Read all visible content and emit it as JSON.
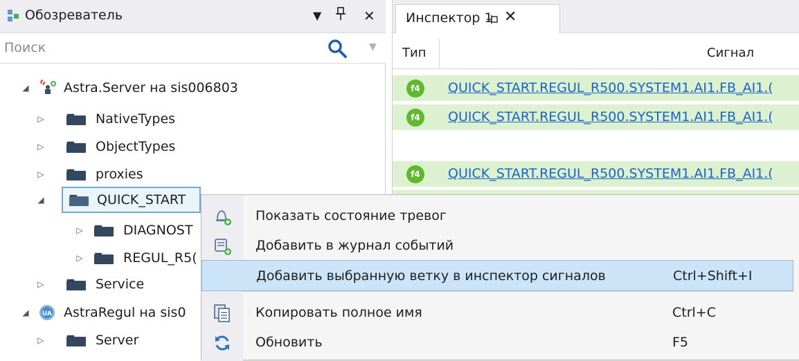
{
  "explorer": {
    "title": "Обозреватель",
    "dropdown_icon": "▼",
    "pin_icon": "ᛘ",
    "close_icon": "✕",
    "search_placeholder": "Поиск",
    "tree": [
      {
        "label": "Astra.Server на sis006803",
        "expanded": true
      },
      {
        "label": "NativeTypes"
      },
      {
        "label": "ObjectTypes"
      },
      {
        "label": "proxies"
      },
      {
        "label": "QUICK_START",
        "expanded": true,
        "selected": true
      },
      {
        "label": "DIAGNOST"
      },
      {
        "label": "REGUL_R5("
      },
      {
        "label": "Service"
      },
      {
        "label": "AstraRegul на sis0",
        "expanded": true
      },
      {
        "label": "Server"
      }
    ]
  },
  "inspector": {
    "tab_label": "Инспектор 1",
    "col_type": "Тип",
    "col_signal": "Сигнал",
    "rows": [
      {
        "badge": "f4",
        "signal": "QUICK_START.REGUL_R500.SYSTEM1.AI1.FB_AI1.("
      },
      {
        "badge": "f4",
        "signal": "QUICK_START.REGUL_R500.SYSTEM1.AI1.FB_AI1.("
      },
      {
        "badge": "",
        "signal": ""
      },
      {
        "badge": "f4",
        "signal": "QUICK_START.REGUL_R500.SYSTEM1.AI1.FB_AI1.("
      }
    ]
  },
  "context_menu": {
    "items": [
      {
        "label": "Показать состояние тревог",
        "shortcut": "",
        "icon": "alarm-bell-icon"
      },
      {
        "label": "Добавить в журнал событий",
        "shortcut": "",
        "icon": "event-log-icon"
      },
      {
        "label": "Добавить выбранную ветку в инспектор сигналов",
        "shortcut": "Ctrl+Shift+I",
        "icon": "",
        "highlighted": true
      },
      {
        "label": "Копировать полное имя",
        "shortcut": "Ctrl+C",
        "icon": "copy-icon"
      },
      {
        "label": "Обновить",
        "shortcut": "F5",
        "icon": "refresh-icon"
      }
    ]
  },
  "colors": {
    "accent": "#1d62c8",
    "row_green": "#dbf1cf",
    "badge_green": "#5fb82e",
    "selection": "#cce4f7"
  }
}
